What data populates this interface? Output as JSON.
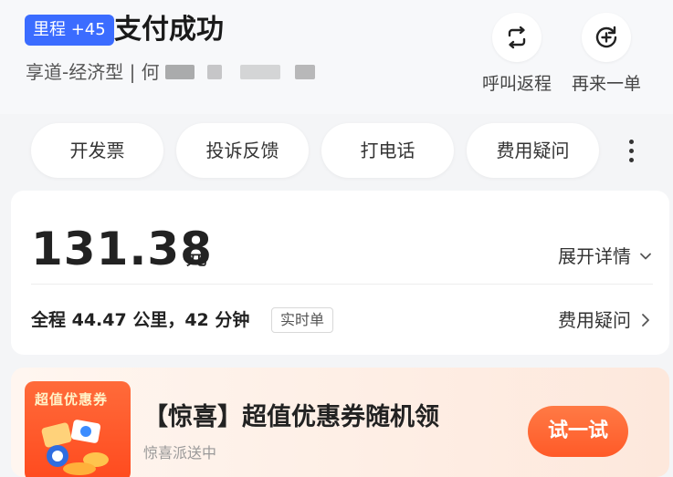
{
  "header": {
    "mileage_badge": "里程 +45",
    "title": "支付成功",
    "subtitle": "享道-经济型 | 何",
    "actions": [
      {
        "label": "呼叫返程",
        "icon": "repeat-icon"
      },
      {
        "label": "再来一单",
        "icon": "reorder-icon"
      }
    ]
  },
  "pills": [
    {
      "label": "开发票"
    },
    {
      "label": "投诉反馈"
    },
    {
      "label": "打电话"
    },
    {
      "label": "费用疑问"
    }
  ],
  "fare": {
    "amount": "131.38",
    "unit": "元",
    "expand_label": "展开详情",
    "trip_info": "全程 44.47 公里，42 分钟",
    "tag": "实时单",
    "fee_question_label": "费用疑问"
  },
  "promo": {
    "thumb_label": "超值优惠券",
    "title": "【惊喜】超值优惠券随机领",
    "subtitle": "惊喜派送中",
    "button_label": "试一试"
  },
  "colors": {
    "accent_blue": "#3b6cff",
    "promo_orange": "#ff5a28",
    "background": "#f4f5f7"
  }
}
